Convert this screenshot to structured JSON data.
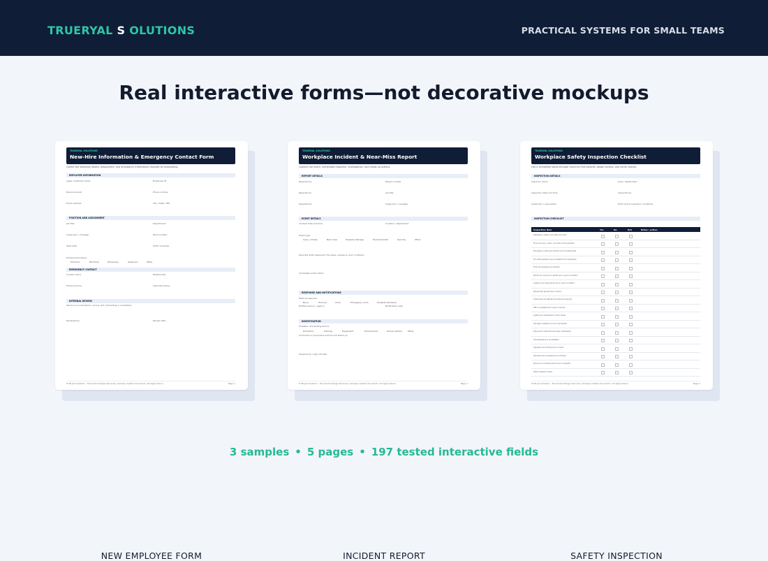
{
  "header": {
    "brand_a": "TRUERYAL ",
    "brand_b": "S",
    "brand_c": " OLUTIONS",
    "tagline": "PRACTICAL SYSTEMS FOR SMALL TEAMS"
  },
  "headline": "Real interactive forms—not decorative mockups",
  "cards": [
    {
      "caption": "NEW EMPLOYEE FORM",
      "kicker": "TRUERYAL SOLUTIONS",
      "title": "New-Hire Information & Emergency Contact Form",
      "intro": "Collect the essential details, assignment, and emergency information required for onboarding.",
      "sections": [
        "EMPLOYEE INFORMATION",
        "POSITION AND ASSIGNMENT",
        "EMERGENCY CONTACT",
        "INTERNAL REVIEW"
      ],
      "fields": [
        "Legal / preferred name",
        "Employee ID",
        "Personal email",
        "Phone number",
        "Home address",
        "City / state / ZIP",
        "Job title",
        "Department",
        "Supervisor / manager",
        "Work location",
        "Start date",
        "Shift / schedule",
        "Employment status",
        "Contact name",
        "Relationship",
        "Primary phone",
        "Alternate phone",
        "Items to provide before, during, and onboarding or orientation",
        "Reviewed by",
        "Review date"
      ],
      "options": [
        "Full-time",
        "Part-time",
        "Temporary",
        "Seasonal",
        "Other"
      ],
      "footer": "TruEryal Solutions · Document Design Services | Sample created document, not legal advice",
      "page": "Page 1"
    },
    {
      "caption": "INCIDENT REPORT",
      "kicker": "TRUERYAL SOLUTIONS",
      "title": "Workplace Incident & Near-Miss Report",
      "intro": "Capture the event, immediate response, investigation, and follow-up actions.",
      "sections": [
        "REPORT DETAILS",
        "EVENT DETAILS",
        "RESPONSE AND NOTIFICATIONS",
        "INVESTIGATION"
      ],
      "fields": [
        "Reported by",
        "Report number",
        "Reported at",
        "Job title",
        "Department",
        "Supervisor / manager",
        "Incident date and time",
        "Location / department",
        "Event type",
        "Describe what happened: the steps, sequence, and conditions",
        "Immediate action taken",
        "Medical response",
        "Notified person / agency",
        "Notification date",
        "Probable contributing factors",
        "Corrective or preventive actions and follow-up",
        "Prepared by / Sign off date"
      ],
      "options": [
        "Injury / illness",
        "Near miss",
        "Property damage",
        "Environmental",
        "Security",
        "Other"
      ],
      "options2": [
        "None",
        "First aid",
        "Clinic",
        "Emergency room",
        "Hospital admission"
      ],
      "options3": [
        "Procedure",
        "Training",
        "Equipment",
        "Environment",
        "Human factors",
        "Other"
      ],
      "footer": "TruEryal Solutions · Document Design Services | Sample created document, not legal advice",
      "page": "Page 1"
    },
    {
      "caption": "SAFETY INSPECTION",
      "kicker": "TRUERYAL SOLUTIONS",
      "title": "Workplace Safety Inspection Checklist",
      "intro": "Use a completed week-through record to find hazards, assign actions, and verify closure.",
      "sections": [
        "INSPECTION DETAILS",
        "INSPECTION CHECKLIST"
      ],
      "fields": [
        "Inspector name",
        "Area / department",
        "Inspection date and time",
        "Inspected by",
        "Supervisor / area leader",
        "Most recent inspection conditions"
      ],
      "table_header": [
        "Inspection item",
        "Yes",
        "No",
        "N/A",
        "Notes / action"
      ],
      "rows": [
        "Walkways, aisles, and exits are clear",
        "Floors are dry, clean, and free of trip hazards",
        "Emergency exits are marked and unobstructed",
        "Fire extinguishers are accessible and inspected",
        "First aid supplies are stocked",
        "Electrical cords and outlets are in good condition",
        "Ladders and step stools are in good condition",
        "Equipment guards are in place",
        "Chemicals are labeled and stored properly",
        "PPE is available and used correctly",
        "Lighting is adequate for work areas",
        "Storage is stable and not overloaded",
        "Ergonomic hazards have been addressed",
        "Housekeeping is acceptable",
        "Signage and postings are current",
        "Spill kits are accessible and stocked",
        "Previous corrective actions are complete",
        "Other hazards noted"
      ],
      "footer": "TruEryal Solutions · Document Design Services | Sample created document, not legal advice",
      "page": "Page 1"
    }
  ],
  "stats": {
    "samples": "3 samples",
    "pages": "5 pages",
    "fields": "197 tested interactive fields",
    "sep": "•"
  },
  "colors": {
    "navy": "#0f1d37",
    "teal": "#2fc7a4",
    "background": "#f2f5fa"
  }
}
